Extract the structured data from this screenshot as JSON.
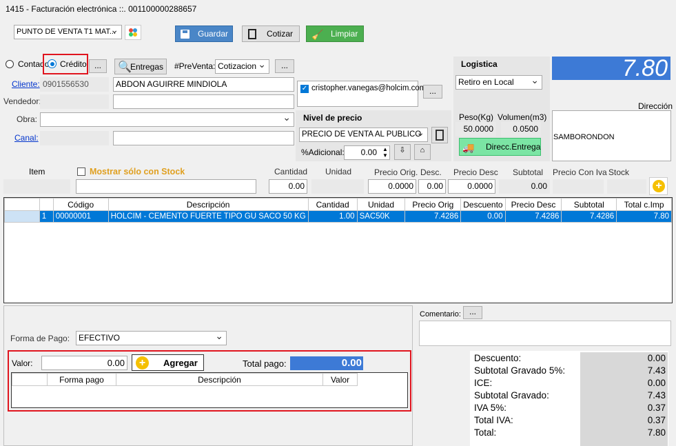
{
  "window": {
    "title": "1415 - Facturación electrónica ::. 001100000288657"
  },
  "toolbar": {
    "point_of_sale": "PUNTO DE VENTA T1 MAT...",
    "save_label": "Guardar",
    "quote_label": "Cotizar",
    "clear_label": "Limpiar"
  },
  "payment_type": {
    "cash_label": "Contado",
    "credit_label": "Crédito",
    "more": "..."
  },
  "deliveries_label": "Entregas",
  "prepurchase": {
    "label": "#PreVenta:",
    "value": "Cotizacion",
    "more": "..."
  },
  "client": {
    "client_label": "Cliente:",
    "client_id": "0901556530",
    "client_name": "ABDON AGUIRRE MINDIOLA",
    "seller_label": "Vendedor:",
    "seller_code": "",
    "seller_name": "",
    "work_label": "Obra:",
    "work_value": "",
    "channel_label": "Canal:",
    "channel_code": "",
    "channel_name": ""
  },
  "email": {
    "value": "cristopher.vanegas@holcim.com",
    "more": "..."
  },
  "price_level": {
    "title": "Nivel de precio",
    "value": "PRECIO DE VENTA AL PUBLICO",
    "additional_label": "%Adicional:",
    "additional_value": "0.00"
  },
  "logistics": {
    "title": "Logistica",
    "mode": "Retiro en Local",
    "weight_label": "Peso(Kg)",
    "weight_value": "50.0000",
    "volume_label": "Volumen(m3)",
    "volume_value": "0.0500",
    "delivery_button": "Direcc.Entrega"
  },
  "total_display": "7.80",
  "address": {
    "label": "Dirección",
    "value": "SAMBORONDON"
  },
  "item_entry": {
    "item_label": "Item",
    "stock_only_label": "Mostrar sólo con Stock",
    "qty_label": "Cantidad",
    "qty_value": "0.00",
    "unit_label": "Unidad",
    "orig_price_label": "Precio Orig.",
    "orig_price_value": "0.0000",
    "disc_label": "Desc.",
    "disc_value": "0.00",
    "disc_price_label": "Precio Desc",
    "disc_price_value": "0.0000",
    "subtotal_label": "Subtotal",
    "subtotal_value": "0.00",
    "price_iva_label": "Precio Con Iva",
    "stock_label": "Stock"
  },
  "items_table": {
    "headers": [
      "Código",
      "Descripción",
      "Cantidad",
      "Unidad",
      "Precio Orig",
      "Descuento",
      "Precio Desc",
      "Subtotal",
      "Total c.Imp"
    ],
    "rows": [
      {
        "n": "1",
        "code": "00000001",
        "desc": "HOLCIM  - CEMENTO FUERTE TIPO GU SACO 50 KG",
        "qty": "1.00",
        "unit": "SAC50K",
        "orig": "7.4286",
        "disc": "0.00",
        "dprice": "7.4286",
        "subtotal": "7.4286",
        "total": "7.80"
      }
    ]
  },
  "payment": {
    "form_label": "Forma de Pago:",
    "form_value": "EFECTIVO",
    "amount_label": "Valor:",
    "amount_value": "0.00",
    "add_button": "Agregar",
    "total_label": "Total pago:",
    "total_value": "0.00",
    "headers": [
      "Forma pago",
      "Descripción",
      "Valor"
    ]
  },
  "comment": {
    "label": "Comentario:",
    "more": "..."
  },
  "summary": [
    {
      "label": "Descuento:",
      "value": "0.00"
    },
    {
      "label": "Subtotal Gravado 5%:",
      "value": "7.43"
    },
    {
      "label": "ICE:",
      "value": "0.00"
    },
    {
      "label": "Subtotal Gravado:",
      "value": "7.43"
    },
    {
      "label": "IVA 5%:",
      "value": "0.37"
    },
    {
      "label": "Total IVA:",
      "value": "0.37"
    },
    {
      "label": "Total:",
      "value": "7.80"
    }
  ]
}
